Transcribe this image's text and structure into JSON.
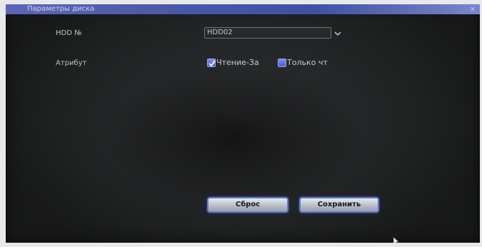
{
  "window": {
    "title": "Параметры диска",
    "close_glyph": "×"
  },
  "form": {
    "hdd_label": "HDD №",
    "hdd_value": "HDD02",
    "attribute_label": "Атрибут",
    "options": [
      {
        "label": "Чтение-За",
        "checked": true
      },
      {
        "label": "Только чт",
        "checked": false
      }
    ]
  },
  "buttons": {
    "reset_label": "Сброс",
    "save_label": "Сохранить"
  },
  "colors": {
    "title_bar": "#4b5aa9",
    "checkbox": "#5b6ee0",
    "button_border": "#5c7bd8"
  },
  "icons": {
    "close": "close-icon",
    "dropdown": "chevron-down-icon",
    "check": "checkmark-icon",
    "pointer": "cursor-icon"
  }
}
